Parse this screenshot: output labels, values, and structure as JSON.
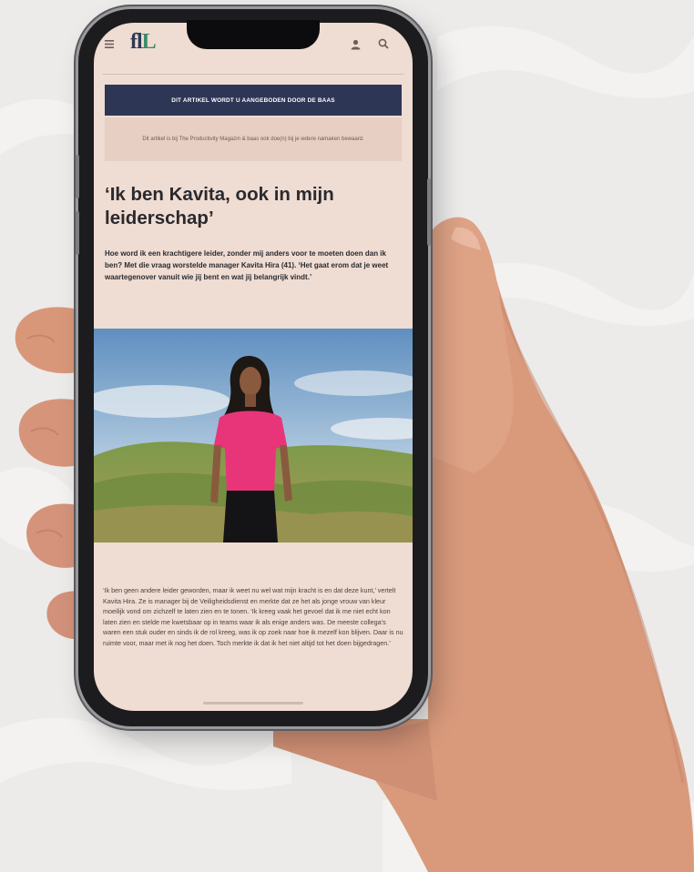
{
  "site": {
    "logo_text": "fl",
    "logo_accent": "L"
  },
  "banner": {
    "label": "DIT ARTIKEL WORDT U AANGEBODEN DOOR DE BAAS"
  },
  "notice": {
    "text": "Dit artikel is bij The Productivity Magazin & baas ook doe(n) bij je iedere namaken bewaard."
  },
  "article": {
    "title": "‘Ik ben Kavita, ook in mijn leiderschap’",
    "intro": "Hoe word ik een krachtigere leider, zonder mij anders voor te moeten doen dan ik ben? Met die vraag worstelde manager Kavita Hira (41). ‘Het gaat erom dat je weet waartegenover vanuit wie jij bent en wat jij belangrijk vindt.’",
    "body": "‘Ik ben geen andere leider geworden, maar ik weet nu wel wat mijn kracht is en dat deze kunt,’ vertelt Kavita Hira. Ze is manager bij de Veiligheidsdienst en merkte dat ze het als jonge vrouw van kleur moeilijk vond om zichzelf te laten zien en te tonen. ‘Ik kreeg vaak het gevoel dat ik me niet echt kon laten zien en stelde me kwetsbaar op in teams waar ik als enige anders was. De meeste collega’s waren een stuk ouder en sinds ik de rol kreeg, was ik op zoek naar hoe ik mezelf kon blijven. Daar is nu ruimte voor, maar met ik nog het doen. Toch merkte ik dat ik het niet altijd tot het doen bijgedragen.’"
  },
  "colors": {
    "page_bg": "#efdcd2",
    "banner_bg": "#2e3656",
    "notice_bg": "#e8cfc3",
    "title_color": "#2a2a2e",
    "shirt": "#e8357a"
  },
  "icons": [
    "hamburger-menu-icon",
    "user-icon",
    "search-icon"
  ]
}
